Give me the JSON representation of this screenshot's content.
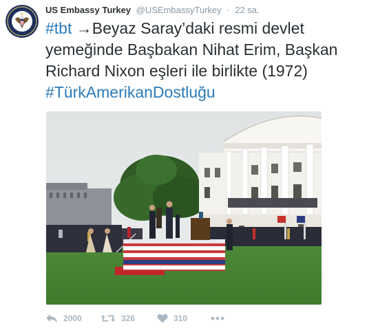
{
  "tweet": {
    "fullname": "US Embassy Turkey",
    "handle": "@USEmbassyTurkey",
    "separator": "·",
    "time": "22 sa.",
    "hashtag1": "#tbt",
    "body_text": " →Beyaz Saray’daki resmi devlet yemeğinde Başbakan Nihat Erim, Başkan Richard Nixon eşleri ile birlikte (1972) ",
    "hashtag2": "#TürkAmerikanDostluğu"
  },
  "actions": {
    "reply_count": "2000",
    "retweet_count": "326",
    "like_count": "310"
  },
  "icons": {
    "avatar": "embassy-seal-icon",
    "reply": "reply-arrow-icon",
    "retweet": "retweet-icon",
    "like": "heart-icon",
    "more": "more-dots-icon"
  },
  "colors": {
    "text": "#292f33",
    "muted": "#8899a6",
    "hashtag": "#2b7bb9",
    "action_gray": "#aab8c2",
    "seal_blue": "#1d2f5e"
  }
}
